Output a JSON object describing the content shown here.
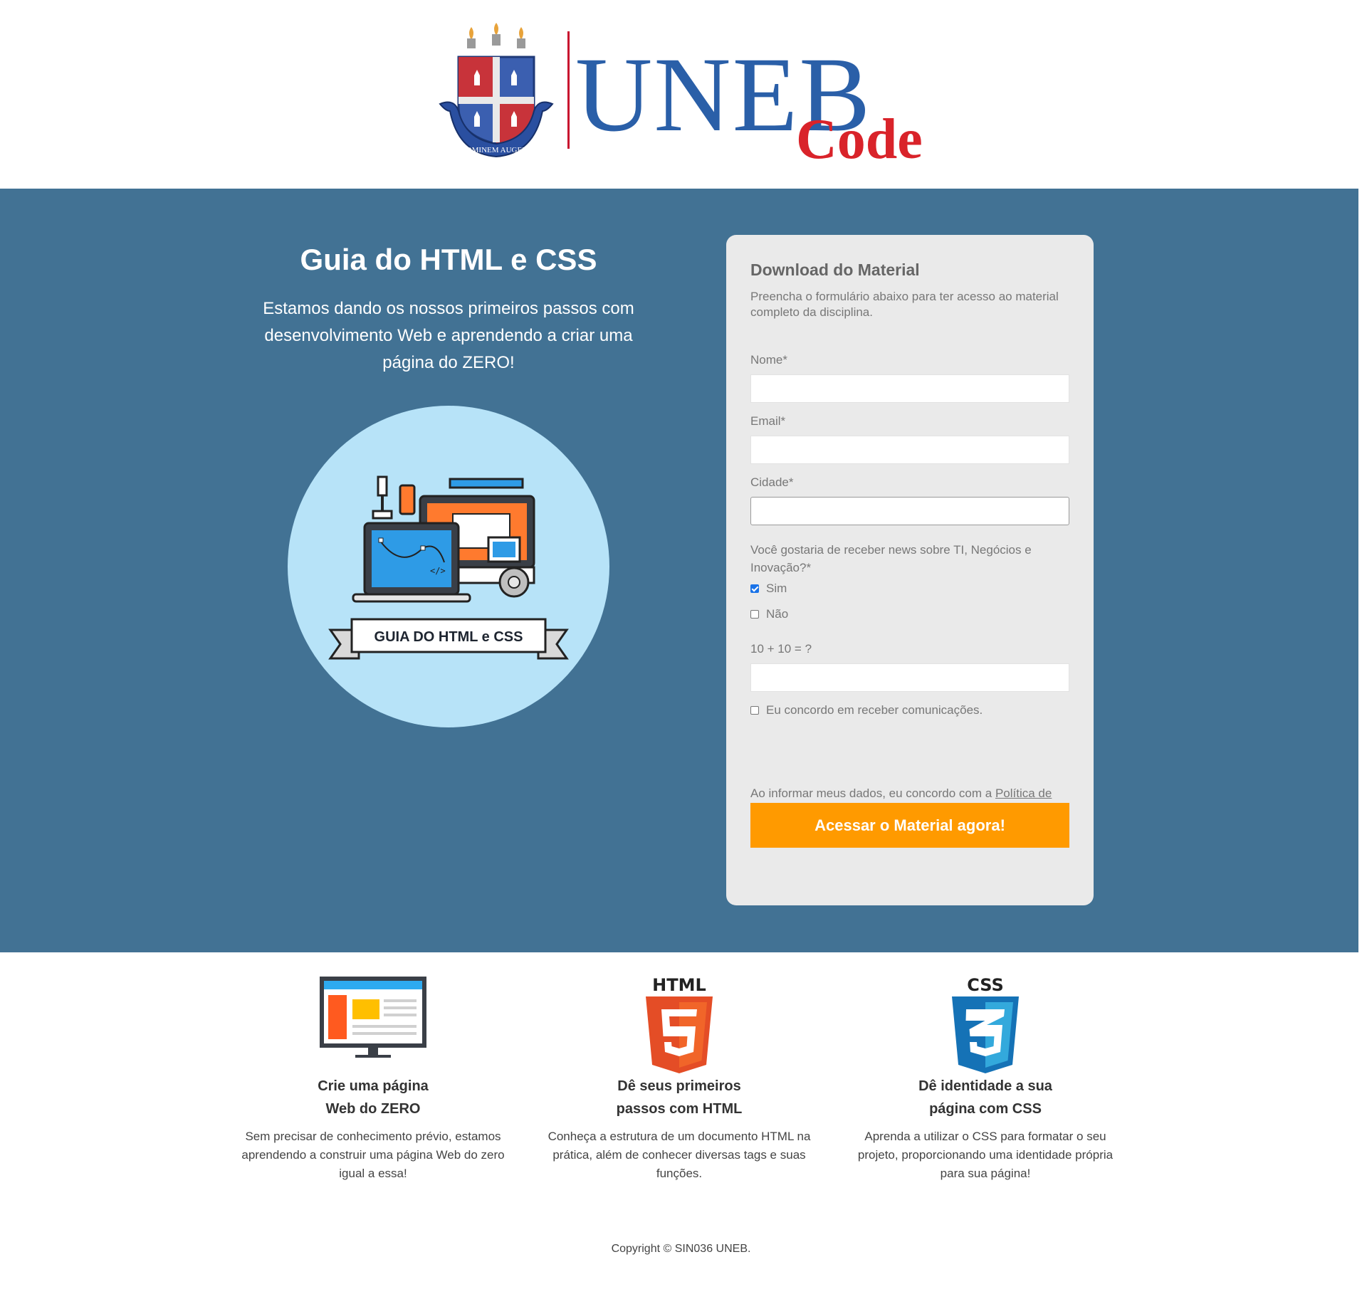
{
  "header": {
    "logo_word": "UNEB",
    "logo_sub": "Code",
    "crest_motto": "HOMINEM AUGERE",
    "colors": {
      "blue": "#2a5fa8",
      "red": "#d9232a"
    }
  },
  "hero": {
    "title": "Guia do HTML e CSS",
    "text": "Estamos dando os nossos primeiros passos com desenvolvimento Web e aprendendo a criar uma página do ZERO!",
    "badge": "GUIA DO HTML e CSS",
    "background": "#427294"
  },
  "form": {
    "title": "Download do Material",
    "intro": "Preencha o formulário abaixo para ter acesso ao material completo da disciplina.",
    "name_label": "Nome*",
    "email_label": "Email*",
    "city_label": "Cidade*",
    "news_question": "Você gostaria de receber news sobre TI, Negócios e Inovação?*",
    "option_yes": "Sim",
    "option_no": "Não",
    "yes_checked": true,
    "no_checked": false,
    "captcha_label": "10 + 10 = ?",
    "consent_label": "Eu concordo em receber comunicações.",
    "consent_checked": false,
    "privacy_text": "Ao informar meus dados, eu concordo com a ",
    "privacy_link": "Política de Privacidade",
    "privacy_end": ".",
    "submit_label": "Acessar o Material agora!",
    "accent": "#ff9a00"
  },
  "features": [
    {
      "icon": "monitor-icon",
      "title_line1": "Crie uma página",
      "title_line2": "Web do ZERO",
      "text": "Sem precisar de conhecimento prévio, estamos aprendendo a construir uma página Web do zero igual a essa!"
    },
    {
      "icon": "html5-icon",
      "icon_label": "HTML",
      "title_line1": "Dê seus primeiros",
      "title_line2": "passos com HTML",
      "text": "Conheça a estrutura de um documento HTML na prática, além de conhecer diversas tags e suas funções."
    },
    {
      "icon": "css3-icon",
      "icon_label": "CSS",
      "title_line1": "Dê identidade a sua",
      "title_line2": "página com CSS",
      "text": "Aprenda a utilizar o CSS para formatar o seu projeto, proporcionando uma identidade própria para sua página!"
    }
  ],
  "footer": {
    "copyright": "Copyright © SIN036 UNEB."
  }
}
